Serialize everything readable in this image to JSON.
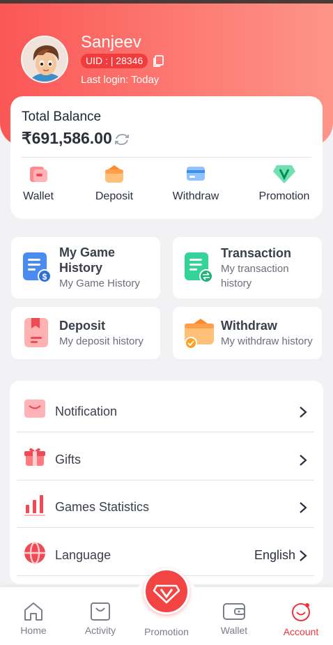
{
  "profile": {
    "name": "Sanjeev",
    "uid_text": "UID : | 28346",
    "last_login": "Last login: Today"
  },
  "balance": {
    "label": "Total Balance",
    "amount": "₹691,586.00"
  },
  "quick_actions": [
    {
      "label": "Wallet",
      "icon": "wallet-icon"
    },
    {
      "label": "Deposit",
      "icon": "deposit-icon"
    },
    {
      "label": "Withdraw",
      "icon": "withdraw-icon"
    },
    {
      "label": "Promotion",
      "icon": "promotion-icon"
    }
  ],
  "tiles": [
    {
      "title": "My Game History",
      "subtitle": "My Game History",
      "icon": "game-history-icon"
    },
    {
      "title": "Transaction",
      "subtitle": "My transaction history",
      "icon": "transaction-icon"
    },
    {
      "title": "Deposit",
      "subtitle": "My deposit history",
      "icon": "deposit-history-icon"
    },
    {
      "title": "Withdraw",
      "subtitle": "My withdraw history",
      "icon": "withdraw-history-icon"
    }
  ],
  "menu": [
    {
      "label": "Notification",
      "icon": "notification-icon"
    },
    {
      "label": "Gifts",
      "icon": "gift-icon"
    },
    {
      "label": "Games Statistics",
      "icon": "statistics-icon"
    },
    {
      "label": "Language",
      "value": "English",
      "icon": "language-icon"
    }
  ],
  "bottom_nav": [
    {
      "label": "Home",
      "icon": "home-icon"
    },
    {
      "label": "Activity",
      "icon": "activity-icon"
    },
    {
      "label": "Promotion",
      "icon": "promotion-diamond-icon"
    },
    {
      "label": "Wallet",
      "icon": "wallet-icon"
    },
    {
      "label": "Account",
      "icon": "account-icon",
      "active": true
    }
  ],
  "colors": {
    "brand_red": "#f34444",
    "header_gradient_start": "#fb5656",
    "header_gradient_end": "#fd9488",
    "active_nav": "#f0353a"
  }
}
